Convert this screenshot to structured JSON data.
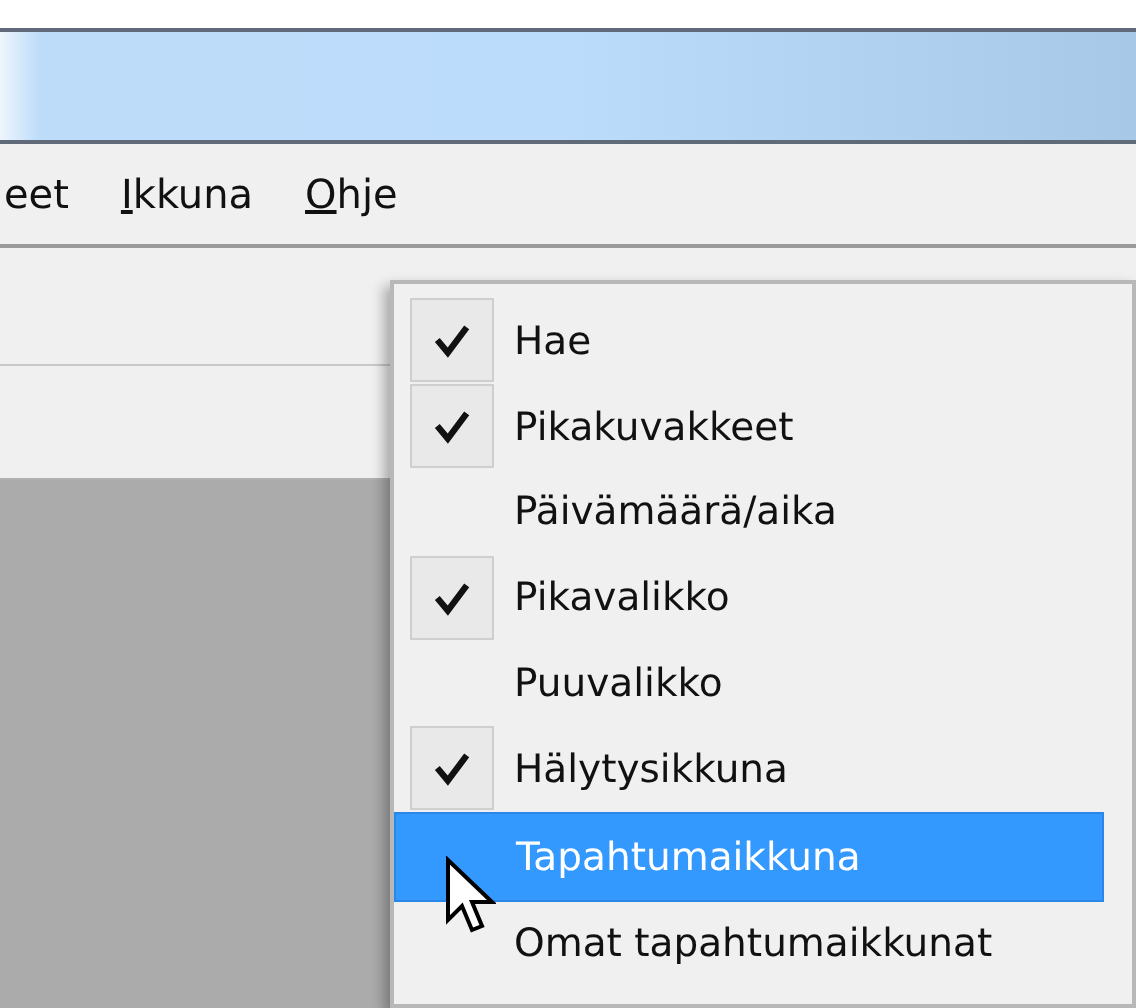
{
  "menu_bar": {
    "items": [
      {
        "label": "eet",
        "access_key_underlined": false
      },
      {
        "label": "Ikkuna",
        "access_key_underlined": true
      },
      {
        "label": "Ohje",
        "access_key_underlined": true
      }
    ]
  },
  "dropdown_menu": {
    "items": [
      {
        "label": "Hae",
        "checked": true,
        "selected": false
      },
      {
        "label": "Pikakuvakkeet",
        "checked": true,
        "selected": false
      },
      {
        "label": "Päivämäärä/aika",
        "checked": false,
        "selected": false
      },
      {
        "label": "Pikavalikko",
        "checked": true,
        "selected": false
      },
      {
        "label": "Puuvalikko",
        "checked": false,
        "selected": false
      },
      {
        "label": "Hälytysikkuna",
        "checked": true,
        "selected": false
      },
      {
        "label": "Tapahtumaikkuna",
        "checked": false,
        "selected": true
      },
      {
        "label": "Omat tapahtumaikkunat",
        "checked": false,
        "selected": false
      }
    ]
  }
}
